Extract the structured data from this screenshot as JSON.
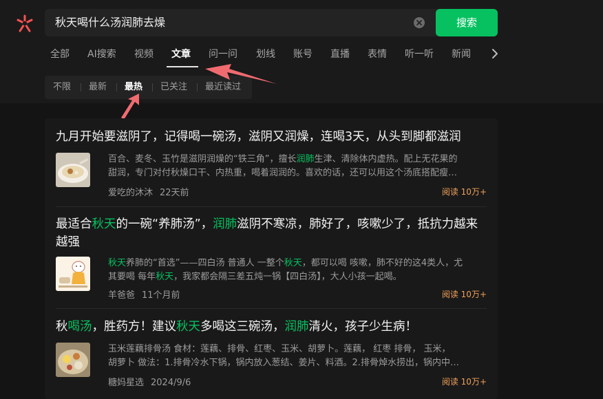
{
  "search": {
    "query": "秋天喝什么汤润肺去燥",
    "button_label": "搜索"
  },
  "tabs": [
    "全部",
    "AI搜索",
    "视频",
    "文章",
    "问一问",
    "划线",
    "账号",
    "直播",
    "表情",
    "听一听",
    "新闻"
  ],
  "active_tab": "文章",
  "filters": [
    "不限",
    "最新",
    "最热",
    "已关注",
    "最近读过"
  ],
  "active_filter": "最热",
  "results": [
    {
      "title_parts": [
        {
          "text": "九月开始要滋阴了，记得喝一碗汤，滋阴又润燥，连喝3天，从头到脚都滋润",
          "hl": false
        }
      ],
      "summary_line1_parts": [
        {
          "text": "百合、麦冬、玉竹是滋阴润燥的“铁三角”，擅长",
          "hl": false
        },
        {
          "text": "润肺",
          "hl": true
        },
        {
          "text": "生津、清除体内虚热。配上无花果的",
          "hl": false
        }
      ],
      "summary_line2_parts": [
        {
          "text": "甜润，专门对付秋燥口干、内热重，喝着润润的。喜欢的话，还可以用这个汤底搭配瘦…",
          "hl": false
        }
      ],
      "author": "爱吃的沐沐",
      "date": "22天前",
      "reads": "阅读 10万+"
    },
    {
      "title_line1_parts": [
        {
          "text": "最适合",
          "hl": false
        },
        {
          "text": "秋天",
          "hl": true
        },
        {
          "text": "的一碗“养肺汤”，",
          "hl": false
        },
        {
          "text": "润肺",
          "hl": true
        },
        {
          "text": "滋阴不寒凉，肺好了，咳嗽少了，抵抗力越来",
          "hl": false
        }
      ],
      "title_line2_parts": [
        {
          "text": "越强",
          "hl": false
        }
      ],
      "summary_line1_parts": [
        {
          "text": "秋天",
          "hl": true
        },
        {
          "text": "养肺的“首选”——四白汤 普通人 一整个",
          "hl": false
        },
        {
          "text": "秋天",
          "hl": true
        },
        {
          "text": "，都可以喝 咳嗽，肺不好的这4类人，尤",
          "hl": false
        }
      ],
      "summary_line2_parts": [
        {
          "text": "其要喝 每年",
          "hl": false
        },
        {
          "text": "秋天",
          "hl": true
        },
        {
          "text": "，我家都会隔三差五炖一锅【四白汤】，大人小孩一起喝。",
          "hl": false
        }
      ],
      "author": "羊爸爸",
      "date": "11个月前",
      "reads": "阅读 10万+"
    },
    {
      "title_parts": [
        {
          "text": "秋",
          "hl": false
        },
        {
          "text": "喝汤",
          "hl": true
        },
        {
          "text": "，胜药方！建议",
          "hl": false
        },
        {
          "text": "秋天",
          "hl": true
        },
        {
          "text": "多喝这三碗汤，",
          "hl": false
        },
        {
          "text": "润肺",
          "hl": true
        },
        {
          "text": "清火，孩子少生病！",
          "hl": false
        }
      ],
      "summary_line1_parts": [
        {
          "text": "玉米莲藕排骨汤 食材：莲藕、排骨、红枣、玉米、胡萝卜。莲藕， 红枣 排骨， 玉米，",
          "hl": false
        }
      ],
      "summary_line2_parts": [
        {
          "text": "胡萝卜 做法：1.排骨冷水下锅，锅内放入葱结、姜片、料酒。2.排骨焯水捞出，锅内中…",
          "hl": false
        }
      ],
      "author": "糖妈星选",
      "date": "2024/9/6",
      "reads": "阅读 10万+"
    }
  ],
  "colors": {
    "accent": "#07c160",
    "reads": "#f1a25b",
    "logo": "#fa5151",
    "annotation_arrow": "#f06b70"
  }
}
